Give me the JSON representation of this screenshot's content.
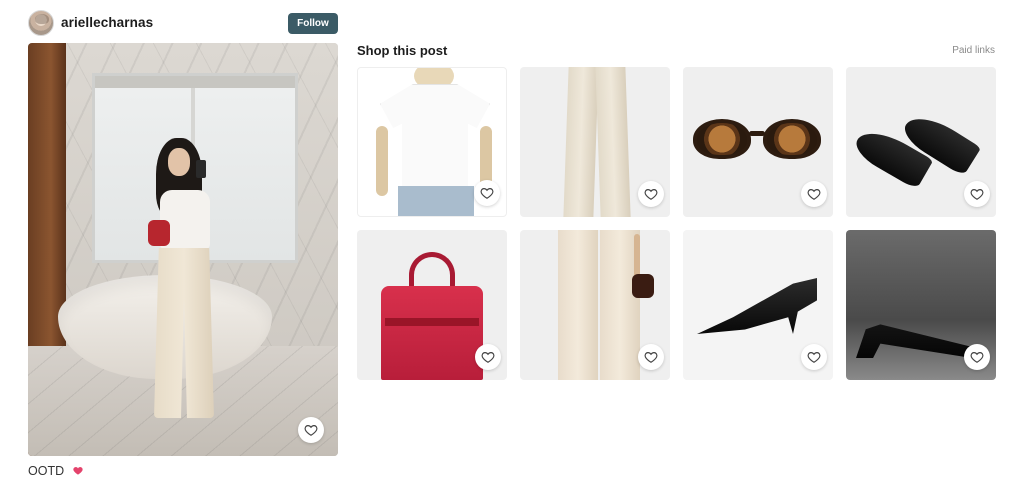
{
  "header": {
    "username": "ariellecharnas",
    "follow_label": "Follow"
  },
  "post": {
    "caption": "OOTD",
    "caption_emoji": "heart-emoji"
  },
  "shop": {
    "title": "Shop this post",
    "paid_links": "Paid links",
    "products": [
      {
        "name": "white-tee"
      },
      {
        "name": "cream-wide-leg-trousers"
      },
      {
        "name": "tortoiseshell-sunglasses"
      },
      {
        "name": "black-kitten-heels"
      },
      {
        "name": "red-tote-bag"
      },
      {
        "name": "cream-trousers-with-bag"
      },
      {
        "name": "black-pointed-pump"
      },
      {
        "name": "black-kitten-heel-dark"
      }
    ]
  },
  "colors": {
    "follow_button": "#3b5b66",
    "heart_emoji": "#e4436c"
  }
}
